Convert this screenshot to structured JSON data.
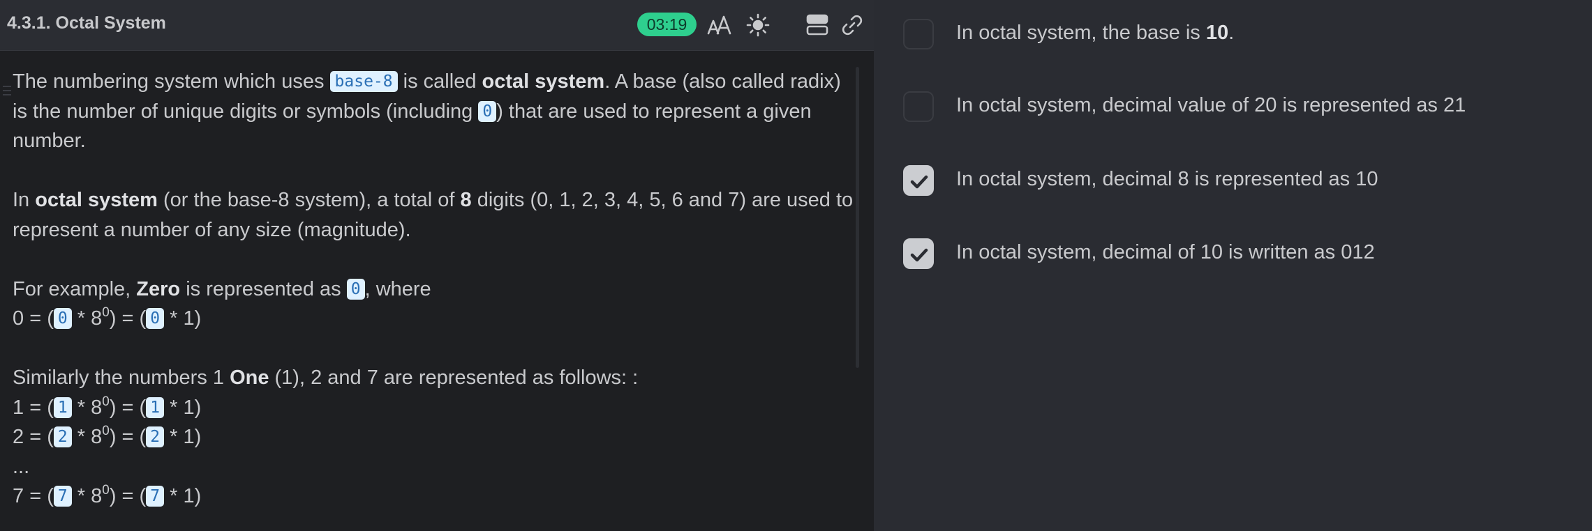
{
  "header": {
    "title": "4.3.1. Octal System",
    "timer": "03:19",
    "icons": [
      "font-size-icon",
      "brightness-icon",
      "layout-icon",
      "link-icon"
    ]
  },
  "content": {
    "p1": {
      "t1": "The numbering system which uses ",
      "code1": "base-8",
      "t2": " is called ",
      "b1": "octal system",
      "t3": ". A base (also called radix) is the number of unique digits or symbols (including ",
      "code2": "0",
      "t4": ") that are used to represent a given number."
    },
    "p2": {
      "t1": "In ",
      "b1": "octal system",
      "t2": " (or the base-8 system), a total of ",
      "b2": "8",
      "t3": " digits (0, 1, 2, 3, 4, 5, 6 and 7) are used to represent a number of any size (magnitude)."
    },
    "p3": {
      "t1": "For example, ",
      "b1": "Zero",
      "t2": " is represented as ",
      "code1": "0",
      "t3": ", where"
    },
    "eq_zero": {
      "lhs": "0",
      "digit": "0"
    },
    "p4": {
      "t1": "Similarly the numbers 1 ",
      "b1": "One",
      "t2": " (1), 2 and 7 are represented as follows: :"
    },
    "eqs": [
      {
        "lhs": "1",
        "digit": "1"
      },
      {
        "lhs": "2",
        "digit": "2"
      }
    ],
    "ellipsis": "...",
    "eq_seven": {
      "lhs": "7",
      "digit": "7"
    },
    "eq_parts": {
      "open": " = (",
      "times_base": " * 8",
      "exp": "0",
      "mid": ") = (",
      "times_one": " * 1)"
    }
  },
  "options": [
    {
      "text": "In octal system, the base is ",
      "bold": "10",
      "suffix": ".",
      "checked": false
    },
    {
      "text": "In octal system, decimal value of 20 is represented as 21",
      "checked": false
    },
    {
      "text": "In octal system, decimal 8 is represented as 10",
      "checked": true
    },
    {
      "text": "In octal system, decimal of 10 is written as 012",
      "checked": true
    }
  ],
  "colors": {
    "timer_bg": "#2ecf8e",
    "code_bg": "#dff1ff",
    "code_fg": "#2a6fb5",
    "checkbox_checked": "#cbcdd1"
  }
}
